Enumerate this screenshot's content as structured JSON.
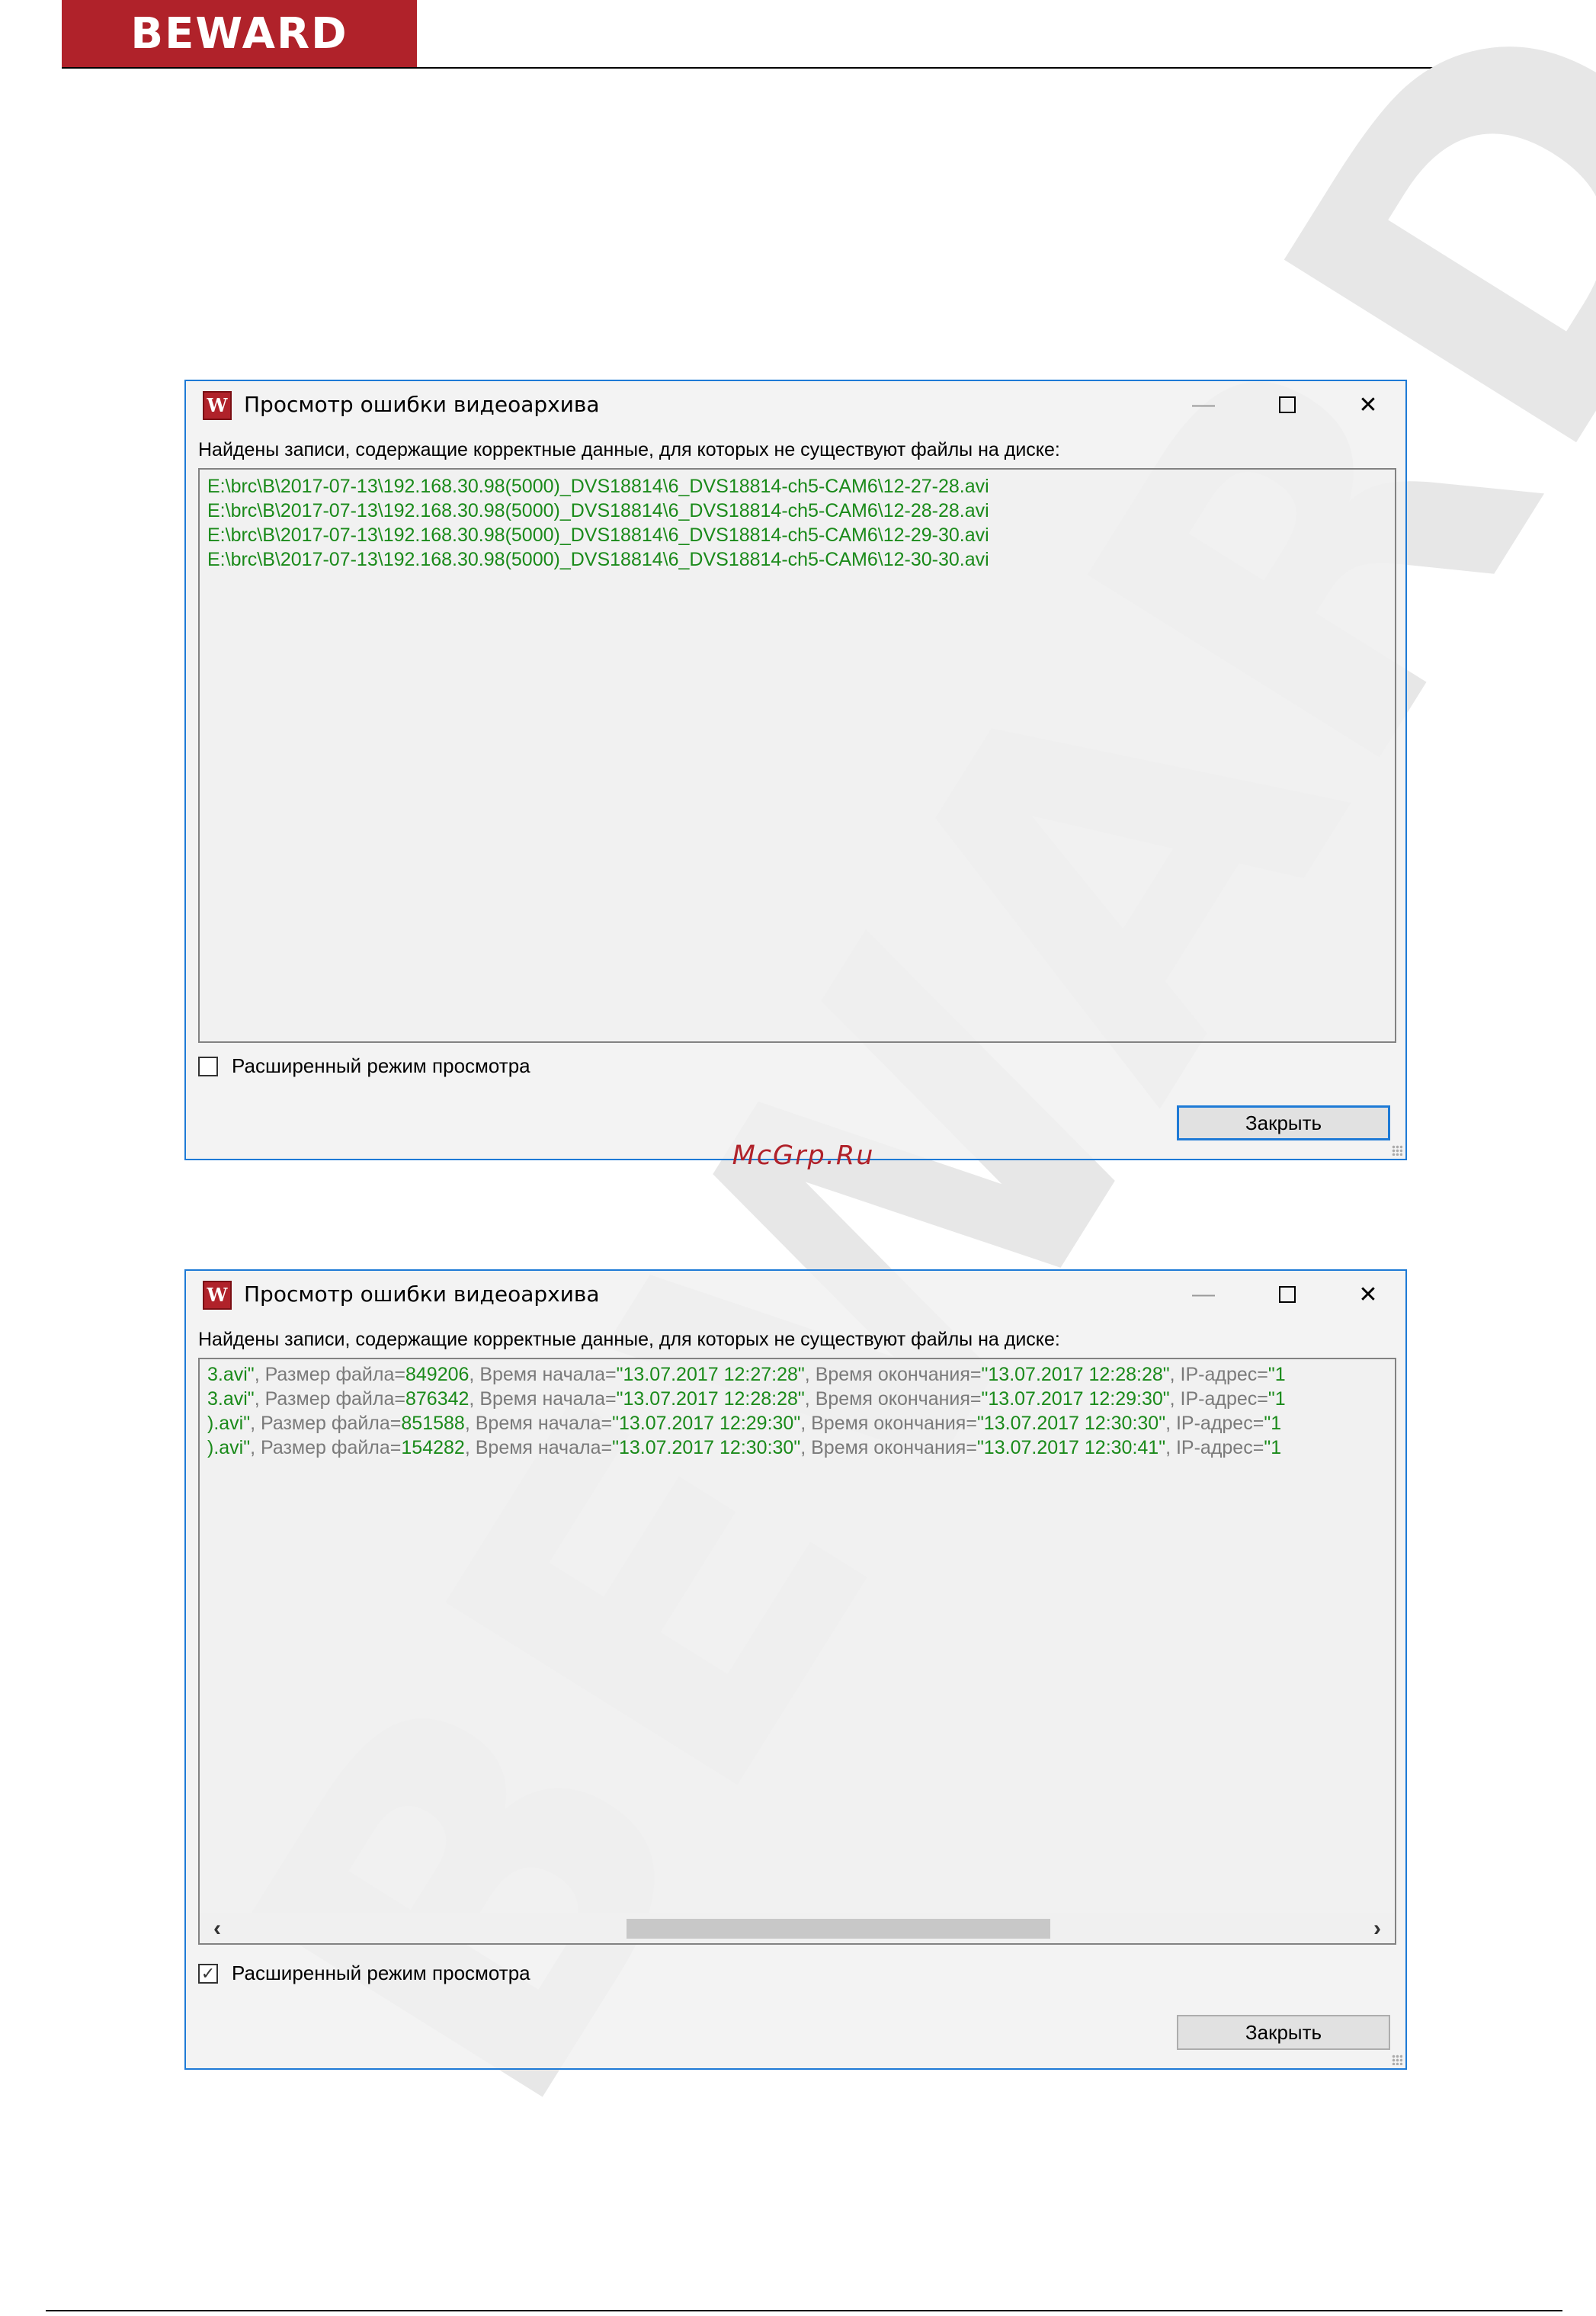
{
  "header": {
    "logo": "BEWARD"
  },
  "watermark": "BEWARD",
  "site_mark": "McGrp.Ru",
  "dialog1": {
    "title": "Просмотр ошибки видеоархива",
    "message": "Найдены записи, содержащие корректные данные, для которых не существуют файлы на диске:",
    "lines": [
      "E:\\brc\\B\\2017-07-13\\192.168.30.98(5000)_DVS18814\\6_DVS18814-ch5-CAM6\\12-27-28.avi",
      "E:\\brc\\B\\2017-07-13\\192.168.30.98(5000)_DVS18814\\6_DVS18814-ch5-CAM6\\12-28-28.avi",
      "E:\\brc\\B\\2017-07-13\\192.168.30.98(5000)_DVS18814\\6_DVS18814-ch5-CAM6\\12-29-30.avi",
      "E:\\brc\\B\\2017-07-13\\192.168.30.98(5000)_DVS18814\\6_DVS18814-ch5-CAM6\\12-30-30.avi"
    ],
    "checkbox_label": "Расширенный режим просмотра",
    "checkbox_checked": false,
    "close_label": "Закрыть"
  },
  "dialog2": {
    "title": "Просмотр ошибки видеоархива",
    "message": "Найдены записи, содержащие корректные данные, для которых не существуют файлы на диске:",
    "rows": [
      {
        "file_tail": "3.avi\"",
        "size_label": ", Размер файла=",
        "size": "849206",
        "start_label": ", Время начала=",
        "start": "\"13.07.2017 12:27:28\"",
        "end_label": ", Время окончания=",
        "end": "\"13.07.2017 12:28:28\"",
        "ip_label": ", IP-адрес=",
        "ip": "\"1"
      },
      {
        "file_tail": "3.avi\"",
        "size_label": ", Размер файла=",
        "size": "876342",
        "start_label": ", Время начала=",
        "start": "\"13.07.2017 12:28:28\"",
        "end_label": ", Время окончания=",
        "end": "\"13.07.2017 12:29:30\"",
        "ip_label": ", IP-адрес=",
        "ip": "\"1"
      },
      {
        "file_tail": ").avi\"",
        "size_label": ", Размер файла=",
        "size": "851588",
        "start_label": ", Время начала=",
        "start": "\"13.07.2017 12:29:30\"",
        "end_label": ", Время окончания=",
        "end": "\"13.07.2017 12:30:30\"",
        "ip_label": ", IP-адрес=",
        "ip": "\"1"
      },
      {
        "file_tail": ").avi\"",
        "size_label": ", Размер файла=",
        "size": "154282",
        "start_label": ", Время начала=",
        "start": "\"13.07.2017 12:30:30\"",
        "end_label": ", Время окончания=",
        "end": "\"13.07.2017 12:30:41\"",
        "ip_label": ", IP-адрес=",
        "ip": "\"1"
      }
    ],
    "checkbox_label": "Расширенный режим просмотра",
    "checkbox_checked": true,
    "close_label": "Закрыть"
  },
  "icons": {
    "app": "beward-app-icon",
    "minimize": "minimize-icon",
    "maximize": "maximize-icon",
    "close": "close-icon",
    "scroll_left": "chevron-left-icon",
    "scroll_right": "chevron-right-icon",
    "check": "checkmark-icon"
  },
  "colors": {
    "brand": "#b0222a",
    "accent": "#1e7ad6",
    "path_text": "#1a8a1a",
    "key_text": "#7a7a7a"
  }
}
